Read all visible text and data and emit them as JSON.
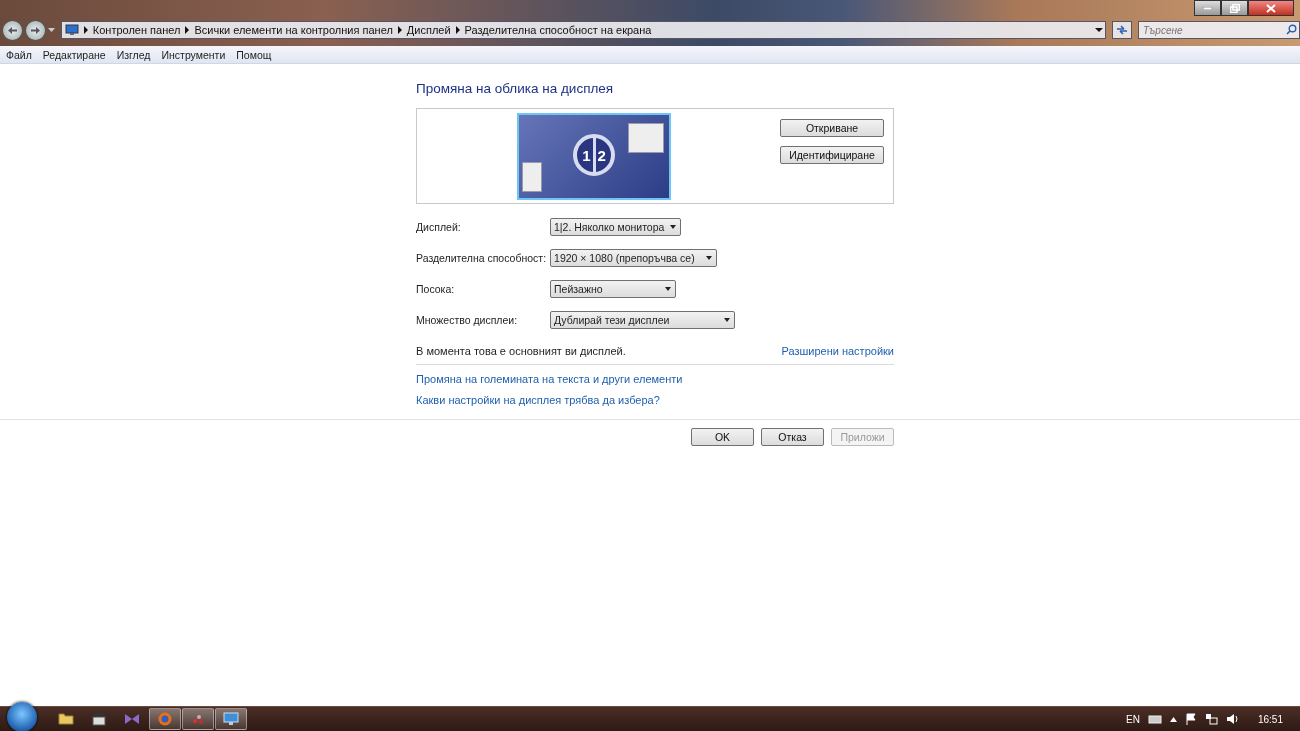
{
  "address_bar": {
    "path": [
      "Контролен панел",
      "Всички елементи на контролния панел",
      "Дисплей",
      "Разделителна способност на екрана"
    ]
  },
  "search": {
    "placeholder": "Търсене"
  },
  "menu": [
    "Файл",
    "Редактиране",
    "Изглед",
    "Инструменти",
    "Помощ"
  ],
  "heading": "Промяна на облика на дисплея",
  "preview": {
    "monitor_numbers": [
      "1",
      "2"
    ],
    "selected": true,
    "buttons": [
      "Откриване",
      "Идентифициране"
    ]
  },
  "settings": [
    {
      "label": "Дисплей:",
      "value": "1|2. Няколко монитора"
    },
    {
      "label": "Разделителна способност:",
      "value": "1920 × 1080 (препоръчва се)"
    },
    {
      "label": "Посока:",
      "value": "Пейзажно"
    },
    {
      "label": "Множество дисплеи:",
      "value": "Дублирай тези дисплеи"
    }
  ],
  "status_text": "В момента това е основният ви дисплей.",
  "advanced_link": "Разширени настройки",
  "links": [
    "Промяна на големината на текста и други елементи",
    "Какви настройки на дисплея трябва да избера?"
  ],
  "dialog_buttons": [
    {
      "label": "OK",
      "disabled": false
    },
    {
      "label": "Отказ",
      "disabled": false
    },
    {
      "label": "Приложи",
      "disabled": true
    }
  ],
  "taskbar": {
    "apps": [
      {
        "kind": "folder",
        "running": false
      },
      {
        "kind": "film",
        "running": false
      },
      {
        "kind": "bowtie",
        "running": false
      },
      {
        "kind": "globe",
        "running": true
      },
      {
        "kind": "dots",
        "running": true
      },
      {
        "kind": "monitor",
        "running": true
      }
    ],
    "language": "EN",
    "time": "16:51"
  }
}
